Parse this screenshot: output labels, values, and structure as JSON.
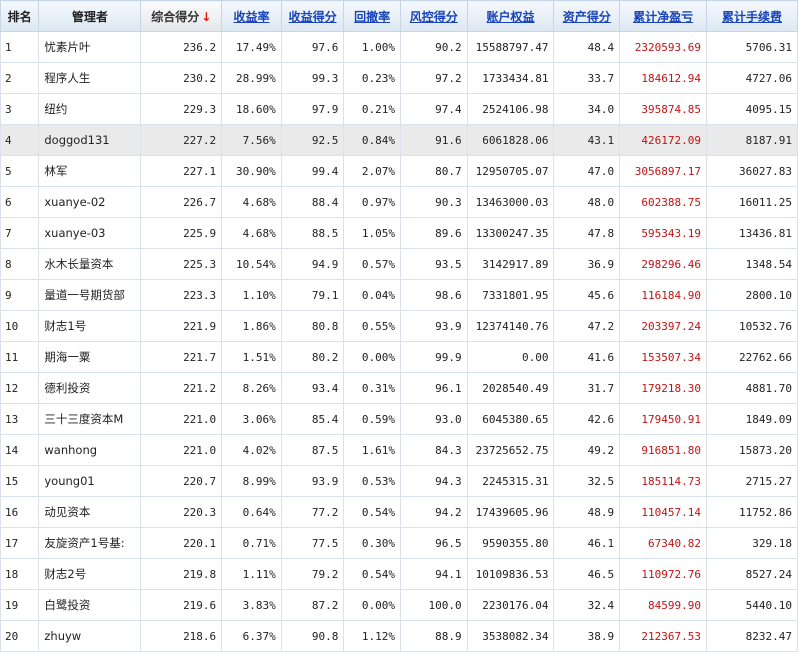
{
  "columns": [
    {
      "label": "排名",
      "sortable": false
    },
    {
      "label": "管理者",
      "sortable": false
    },
    {
      "label": "综合得分",
      "sortable": false,
      "sorted": true,
      "sort_arrow": "↓"
    },
    {
      "label": "收益率",
      "sortable": true
    },
    {
      "label": "收益得分",
      "sortable": true
    },
    {
      "label": "回撤率",
      "sortable": true
    },
    {
      "label": "风控得分",
      "sortable": true
    },
    {
      "label": "账户权益",
      "sortable": true
    },
    {
      "label": "资产得分",
      "sortable": true
    },
    {
      "label": "累计净盈亏",
      "sortable": true
    },
    {
      "label": "累计手续费",
      "sortable": true
    }
  ],
  "rows": [
    {
      "rank": "1",
      "name": "忧素片叶",
      "score": "236.2",
      "return_rate": "17.49%",
      "return_score": "97.6",
      "drawdown": "1.00%",
      "risk_score": "90.2",
      "equity": "15588797.47",
      "asset_score": "48.4",
      "net_pnl": "2320593.69",
      "fees": "5706.31"
    },
    {
      "rank": "2",
      "name": "程序人生",
      "score": "230.2",
      "return_rate": "28.99%",
      "return_score": "99.3",
      "drawdown": "0.23%",
      "risk_score": "97.2",
      "equity": "1733434.81",
      "asset_score": "33.7",
      "net_pnl": "184612.94",
      "fees": "4727.06"
    },
    {
      "rank": "3",
      "name": "纽约",
      "score": "229.3",
      "return_rate": "18.60%",
      "return_score": "97.9",
      "drawdown": "0.21%",
      "risk_score": "97.4",
      "equity": "2524106.98",
      "asset_score": "34.0",
      "net_pnl": "395874.85",
      "fees": "4095.15"
    },
    {
      "rank": "4",
      "name": "doggod131",
      "score": "227.2",
      "return_rate": "7.56%",
      "return_score": "92.5",
      "drawdown": "0.84%",
      "risk_score": "91.6",
      "equity": "6061828.06",
      "asset_score": "43.1",
      "net_pnl": "426172.09",
      "fees": "8187.91",
      "highlight": true
    },
    {
      "rank": "5",
      "name": "林军",
      "score": "227.1",
      "return_rate": "30.90%",
      "return_score": "99.4",
      "drawdown": "2.07%",
      "risk_score": "80.7",
      "equity": "12950705.07",
      "asset_score": "47.0",
      "net_pnl": "3056897.17",
      "fees": "36027.83"
    },
    {
      "rank": "6",
      "name": "xuanye-02",
      "score": "226.7",
      "return_rate": "4.68%",
      "return_score": "88.4",
      "drawdown": "0.97%",
      "risk_score": "90.3",
      "equity": "13463000.03",
      "asset_score": "48.0",
      "net_pnl": "602388.75",
      "fees": "16011.25"
    },
    {
      "rank": "7",
      "name": "xuanye-03",
      "score": "225.9",
      "return_rate": "4.68%",
      "return_score": "88.5",
      "drawdown": "1.05%",
      "risk_score": "89.6",
      "equity": "13300247.35",
      "asset_score": "47.8",
      "net_pnl": "595343.19",
      "fees": "13436.81"
    },
    {
      "rank": "8",
      "name": "水木长量资本",
      "score": "225.3",
      "return_rate": "10.54%",
      "return_score": "94.9",
      "drawdown": "0.57%",
      "risk_score": "93.5",
      "equity": "3142917.89",
      "asset_score": "36.9",
      "net_pnl": "298296.46",
      "fees": "1348.54"
    },
    {
      "rank": "9",
      "name": "量道一号期货部",
      "score": "223.3",
      "return_rate": "1.10%",
      "return_score": "79.1",
      "drawdown": "0.04%",
      "risk_score": "98.6",
      "equity": "7331801.95",
      "asset_score": "45.6",
      "net_pnl": "116184.90",
      "fees": "2800.10"
    },
    {
      "rank": "10",
      "name": "财志1号",
      "score": "221.9",
      "return_rate": "1.86%",
      "return_score": "80.8",
      "drawdown": "0.55%",
      "risk_score": "93.9",
      "equity": "12374140.76",
      "asset_score": "47.2",
      "net_pnl": "203397.24",
      "fees": "10532.76"
    },
    {
      "rank": "11",
      "name": "期海一粟",
      "score": "221.7",
      "return_rate": "1.51%",
      "return_score": "80.2",
      "drawdown": "0.00%",
      "risk_score": "99.9",
      "equity": "0.00",
      "asset_score": "41.6",
      "net_pnl": "153507.34",
      "fees": "22762.66"
    },
    {
      "rank": "12",
      "name": "德利投资",
      "score": "221.2",
      "return_rate": "8.26%",
      "return_score": "93.4",
      "drawdown": "0.31%",
      "risk_score": "96.1",
      "equity": "2028540.49",
      "asset_score": "31.7",
      "net_pnl": "179218.30",
      "fees": "4881.70"
    },
    {
      "rank": "13",
      "name": "三十三度资本M",
      "score": "221.0",
      "return_rate": "3.06%",
      "return_score": "85.4",
      "drawdown": "0.59%",
      "risk_score": "93.0",
      "equity": "6045380.65",
      "asset_score": "42.6",
      "net_pnl": "179450.91",
      "fees": "1849.09"
    },
    {
      "rank": "14",
      "name": "wanhong",
      "score": "221.0",
      "return_rate": "4.02%",
      "return_score": "87.5",
      "drawdown": "1.61%",
      "risk_score": "84.3",
      "equity": "23725652.75",
      "asset_score": "49.2",
      "net_pnl": "916851.80",
      "fees": "15873.20"
    },
    {
      "rank": "15",
      "name": "young01",
      "score": "220.7",
      "return_rate": "8.99%",
      "return_score": "93.9",
      "drawdown": "0.53%",
      "risk_score": "94.3",
      "equity": "2245315.31",
      "asset_score": "32.5",
      "net_pnl": "185114.73",
      "fees": "2715.27"
    },
    {
      "rank": "16",
      "name": "动见资本",
      "score": "220.3",
      "return_rate": "0.64%",
      "return_score": "77.2",
      "drawdown": "0.54%",
      "risk_score": "94.2",
      "equity": "17439605.96",
      "asset_score": "48.9",
      "net_pnl": "110457.14",
      "fees": "11752.86"
    },
    {
      "rank": "17",
      "name": "友旋资产1号基:",
      "score": "220.1",
      "return_rate": "0.71%",
      "return_score": "77.5",
      "drawdown": "0.30%",
      "risk_score": "96.5",
      "equity": "9590355.80",
      "asset_score": "46.1",
      "net_pnl": "67340.82",
      "fees": "329.18"
    },
    {
      "rank": "18",
      "name": "财志2号",
      "score": "219.8",
      "return_rate": "1.11%",
      "return_score": "79.2",
      "drawdown": "0.54%",
      "risk_score": "94.1",
      "equity": "10109836.53",
      "asset_score": "46.5",
      "net_pnl": "110972.76",
      "fees": "8527.24"
    },
    {
      "rank": "19",
      "name": "白鹭投资",
      "score": "219.6",
      "return_rate": "3.83%",
      "return_score": "87.2",
      "drawdown": "0.00%",
      "risk_score": "100.0",
      "equity": "2230176.04",
      "asset_score": "32.4",
      "net_pnl": "84599.90",
      "fees": "5440.10"
    },
    {
      "rank": "20",
      "name": "zhuyw",
      "score": "218.6",
      "return_rate": "6.37%",
      "return_score": "90.8",
      "drawdown": "1.12%",
      "risk_score": "88.9",
      "equity": "3538082.34",
      "asset_score": "38.9",
      "net_pnl": "212367.53",
      "fees": "8232.47"
    }
  ],
  "colors": {
    "link": "#1a44b8",
    "profit": "#c41212",
    "sort_arrow": "#d81e06",
    "highlight_row": "#eaeaea"
  }
}
